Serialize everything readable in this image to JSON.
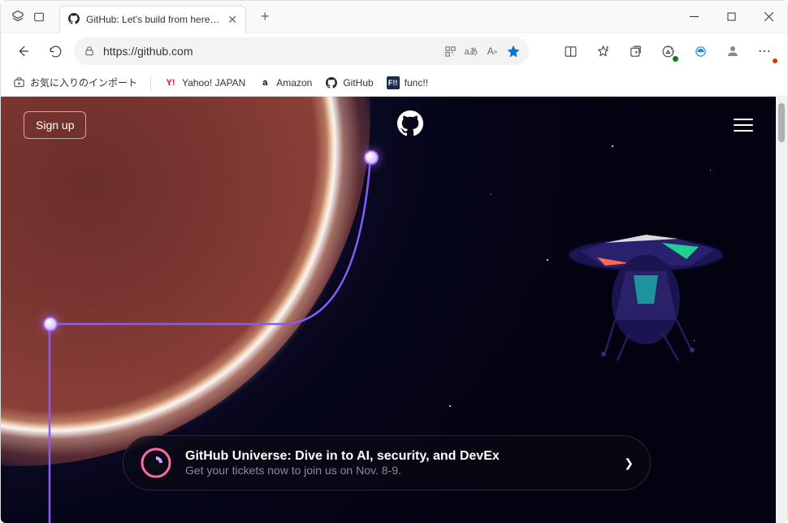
{
  "tab": {
    "title": "GitHub: Let's build from here · Gi"
  },
  "address": {
    "url": "https://github.com"
  },
  "bookmarks": {
    "import_label": "お気に入りのインポート",
    "items": [
      {
        "label": "Yahoo! JAPAN"
      },
      {
        "label": "Amazon"
      },
      {
        "label": "GitHub"
      },
      {
        "label": "func!!"
      }
    ]
  },
  "page": {
    "signup": "Sign up",
    "callout": {
      "title": "GitHub Universe: Dive in to AI, security, and DevEx",
      "subtitle": "Get your tickets now to join us on Nov. 8-9."
    }
  }
}
